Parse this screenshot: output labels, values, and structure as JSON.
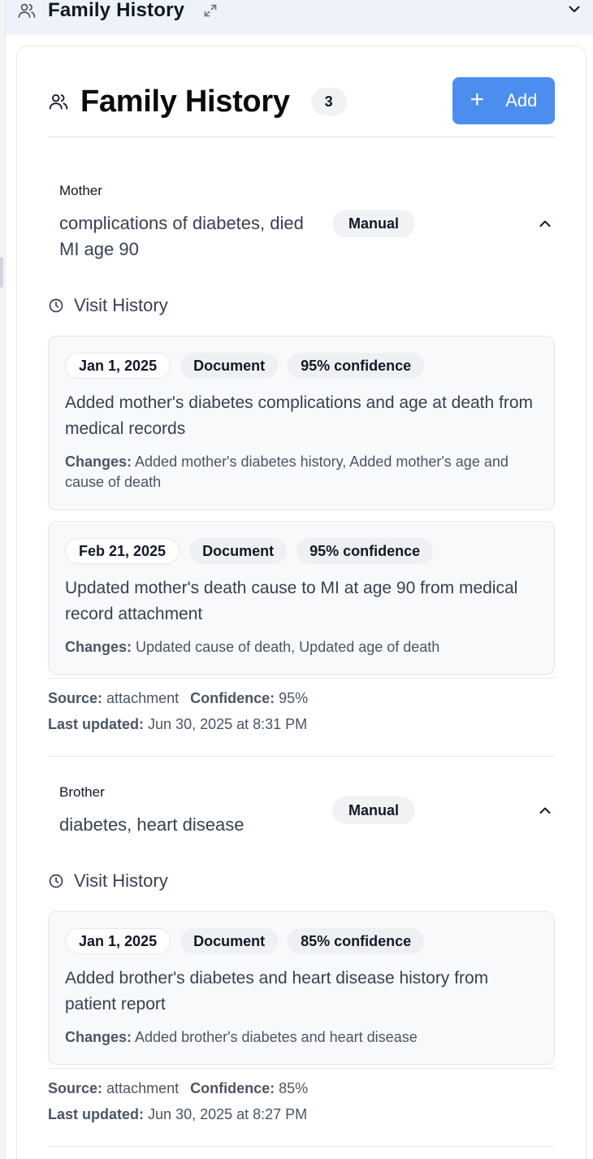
{
  "panel": {
    "title": "Family History"
  },
  "card": {
    "title": "Family History",
    "count": "3",
    "add_label": "Add"
  },
  "labels": {
    "visit_history": "Visit History",
    "changes": "Changes:",
    "source": "Source:",
    "confidence": "Confidence:",
    "last_updated": "Last updated:"
  },
  "members": [
    {
      "relation": "Mother",
      "condition": "complications of diabetes, died MI age 90",
      "badge": "Manual",
      "visits": [
        {
          "date": "Jan 1, 2025",
          "type": "Document",
          "confidence": "95% confidence",
          "summary": "Added mother's diabetes complications and age at death from medical records",
          "changes": "Added mother's diabetes history, Added mother's age and cause of death"
        },
        {
          "date": "Feb 21, 2025",
          "type": "Document",
          "confidence": "95% confidence",
          "summary": "Updated mother's death cause to MI at age 90 from medical record attachment",
          "changes": "Updated cause of death, Updated age of death"
        }
      ],
      "source": "attachment",
      "confidence": "95%",
      "last_updated": "Jun 30, 2025 at 8:31 PM"
    },
    {
      "relation": "Brother",
      "condition": "diabetes, heart disease",
      "badge": "Manual",
      "visits": [
        {
          "date": "Jan 1, 2025",
          "type": "Document",
          "confidence": "85% confidence",
          "summary": "Added brother's diabetes and heart disease history from patient report",
          "changes": "Added brother's diabetes and heart disease"
        }
      ],
      "source": "attachment",
      "confidence": "85%",
      "last_updated": "Jun 30, 2025 at 8:27 PM"
    }
  ],
  "colors": {
    "accent": "#4c8ef0",
    "topbar_bg": "#eef3fb",
    "badge_bg": "#f1f2f4"
  }
}
